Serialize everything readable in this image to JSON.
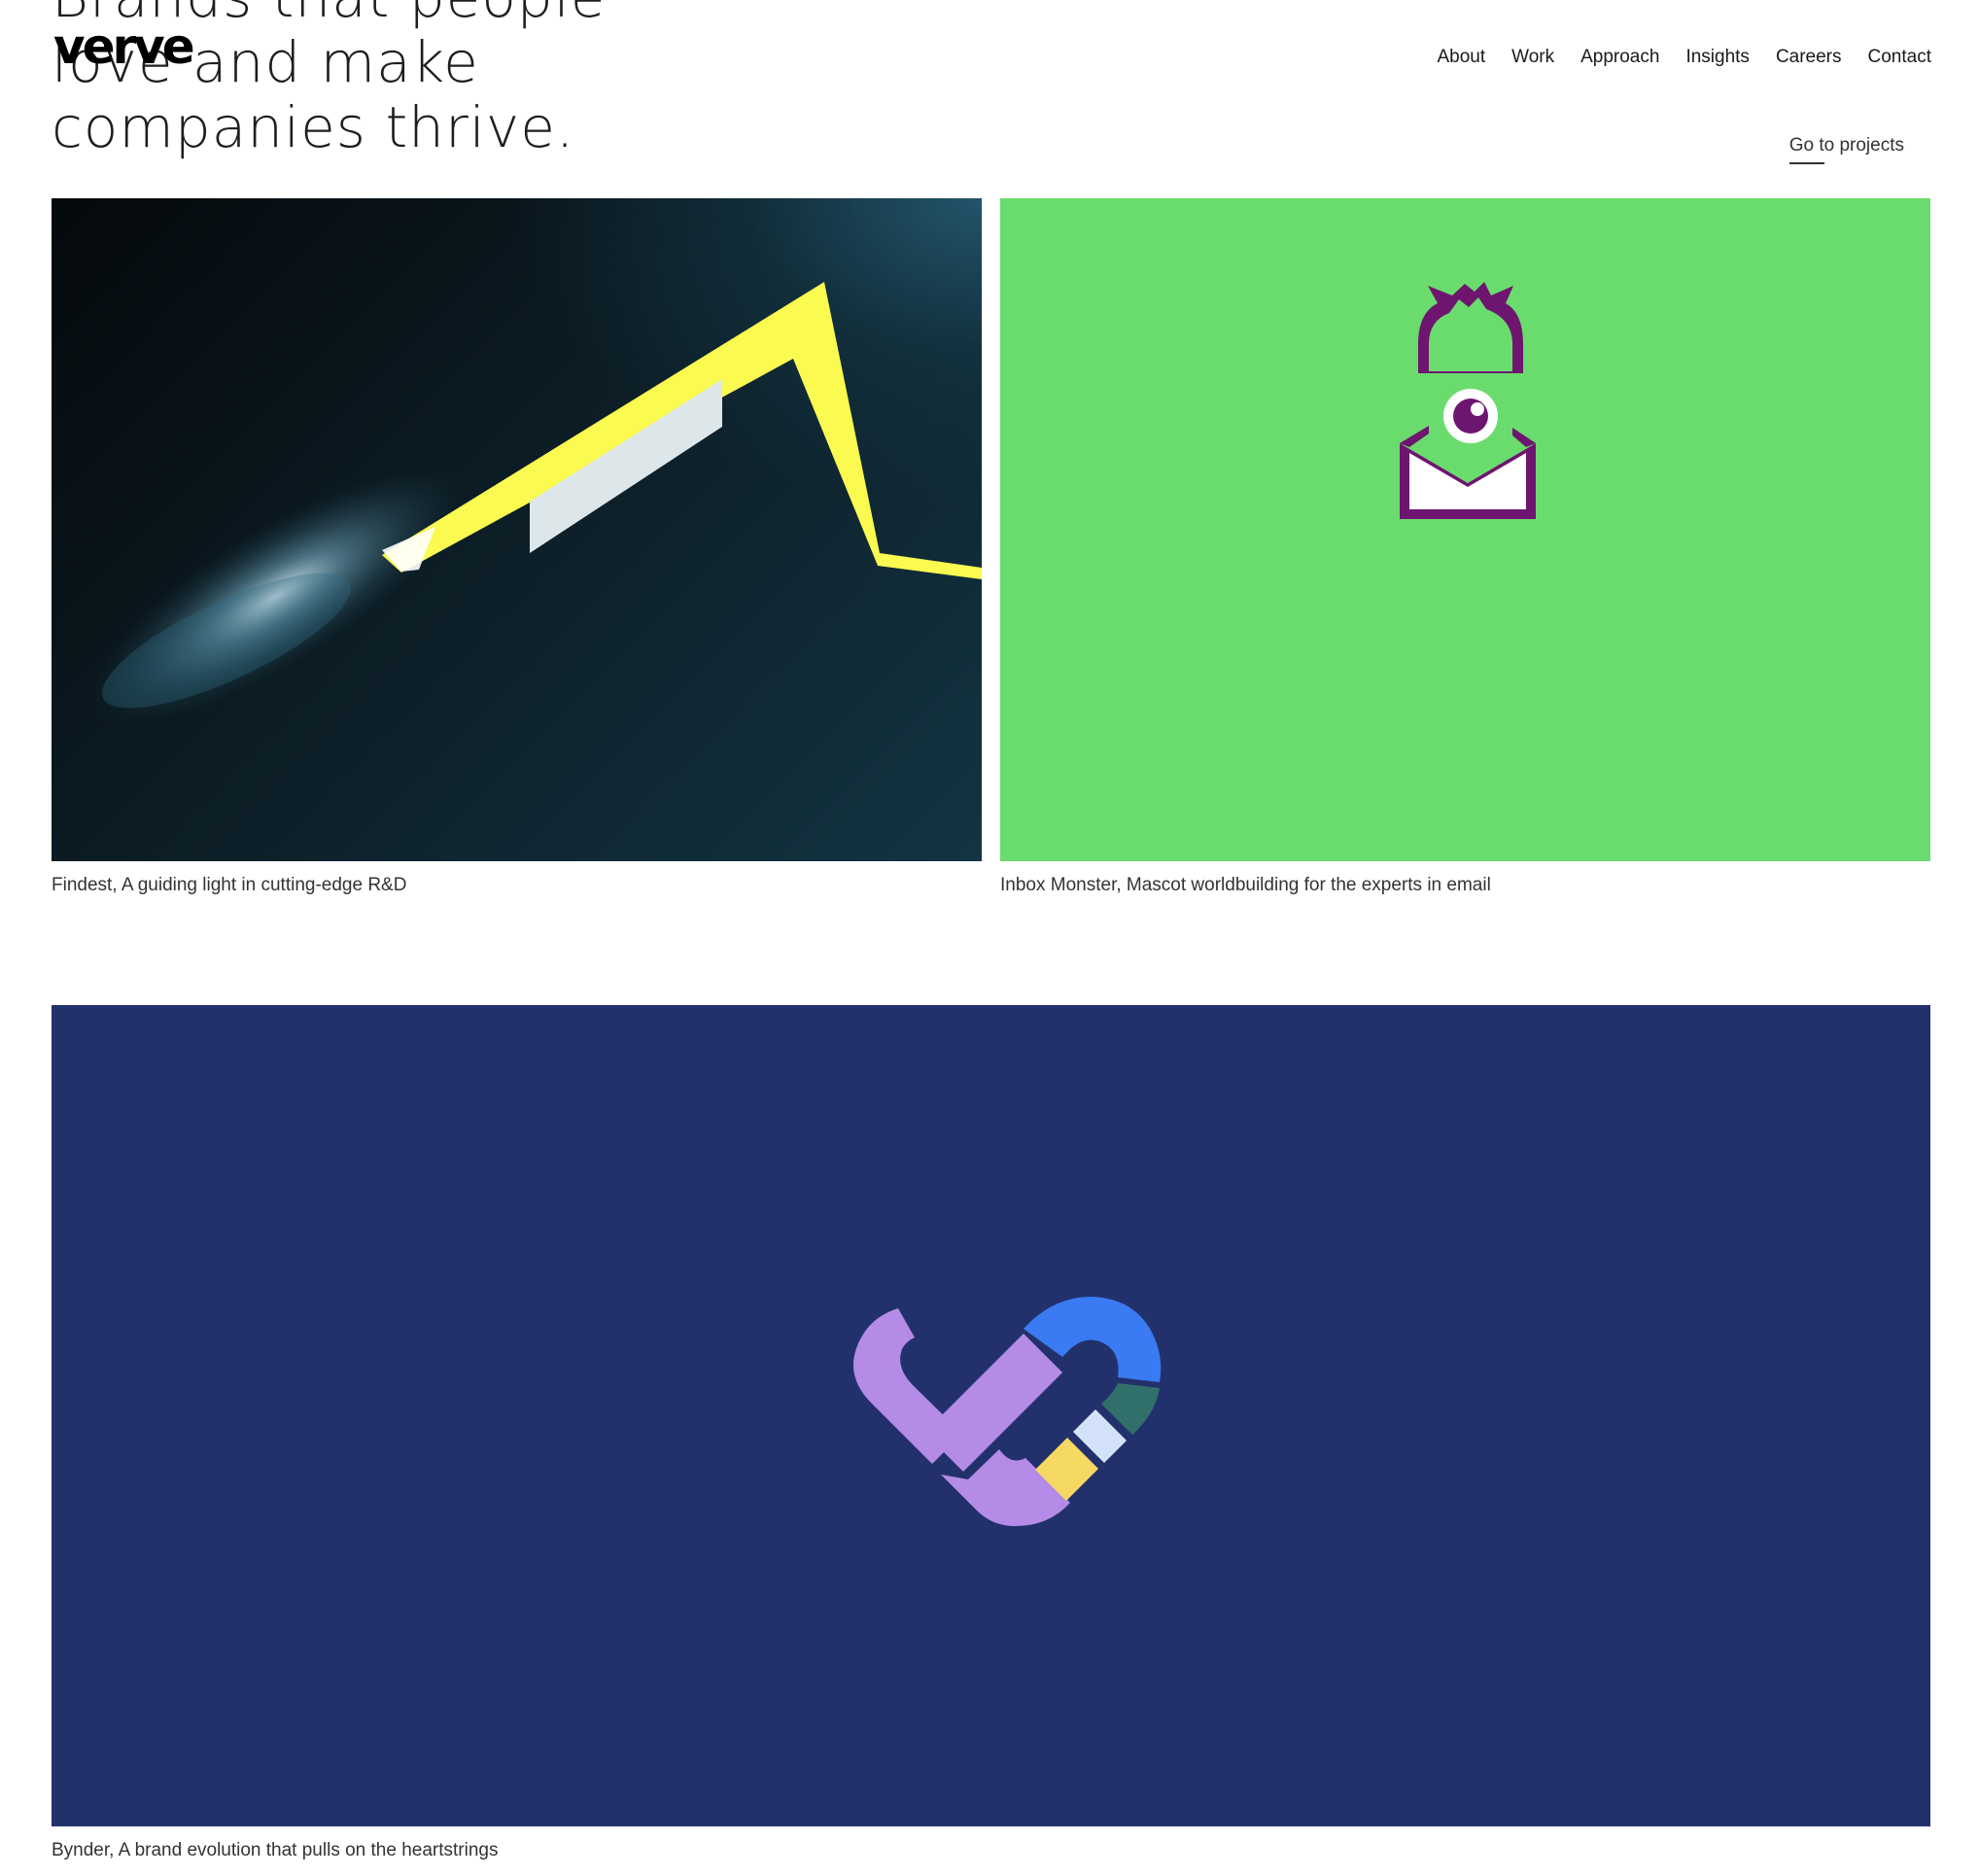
{
  "header": {
    "hero_title": "Brands that people\nlove and make\ncompanies thrive.",
    "logo": "verve",
    "nav": {
      "about": "About",
      "work": "Work",
      "approach": "Approach",
      "insights": "Insights",
      "careers": "Careers",
      "contact": "Contact"
    },
    "go_to_projects": "Go to projects"
  },
  "projects": [
    {
      "caption": "Findest, A guiding light in cutting-edge R&D",
      "background": "#0c1c24",
      "accent": "#fafa50"
    },
    {
      "caption": "Inbox Monster, Mascot worldbuilding for the experts in email",
      "background": "#69dc6d",
      "accent": "#6e1570",
      "icon": "monster-envelope-icon"
    },
    {
      "caption": "Bynder, A brand evolution that pulls on the heartstrings",
      "background": "#22316b",
      "accent": "#b58be8",
      "icon": "bynder-heart-logo-icon"
    }
  ]
}
